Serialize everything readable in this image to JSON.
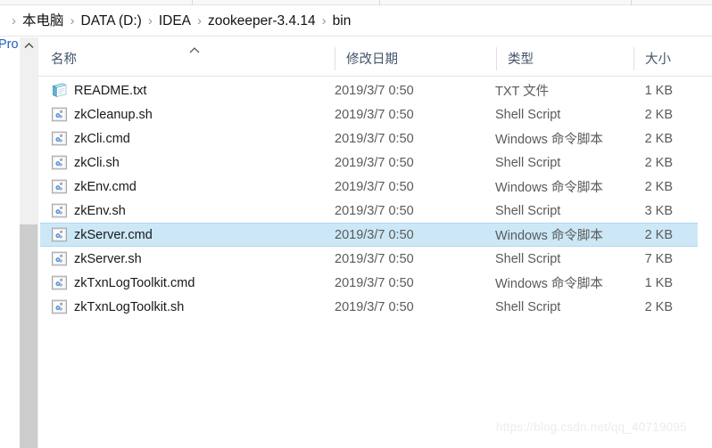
{
  "window": {
    "app": "file-explorer"
  },
  "breadcrumb": {
    "separator": "›",
    "items": [
      {
        "label": "本电脑"
      },
      {
        "label": "DATA (D:)"
      },
      {
        "label": "IDEA"
      },
      {
        "label": "zookeeper-3.4.14"
      },
      {
        "label": "bin"
      }
    ]
  },
  "navigation_pane": {
    "clipped_item_label": "Pro",
    "scrollbar": {
      "up_arrow_icon": "chevron-up-icon"
    }
  },
  "columns": {
    "name": "名称",
    "date_modified": "修改日期",
    "type": "类型",
    "size": "大小",
    "sort_column": "名称",
    "sort_direction_icon": "sort-ascending-icon"
  },
  "files": [
    {
      "name": "README.txt",
      "date": "2019/3/7 0:50",
      "type": "TXT 文件",
      "size": "1 KB",
      "icon": "text-document-icon",
      "selected": false
    },
    {
      "name": "zkCleanup.sh",
      "date": "2019/3/7 0:50",
      "type": "Shell Script",
      "size": "2 KB",
      "icon": "script-file-icon",
      "selected": false
    },
    {
      "name": "zkCli.cmd",
      "date": "2019/3/7 0:50",
      "type": "Windows 命令脚本",
      "size": "2 KB",
      "icon": "script-file-icon",
      "selected": false
    },
    {
      "name": "zkCli.sh",
      "date": "2019/3/7 0:50",
      "type": "Shell Script",
      "size": "2 KB",
      "icon": "script-file-icon",
      "selected": false
    },
    {
      "name": "zkEnv.cmd",
      "date": "2019/3/7 0:50",
      "type": "Windows 命令脚本",
      "size": "2 KB",
      "icon": "script-file-icon",
      "selected": false
    },
    {
      "name": "zkEnv.sh",
      "date": "2019/3/7 0:50",
      "type": "Shell Script",
      "size": "3 KB",
      "icon": "script-file-icon",
      "selected": false
    },
    {
      "name": "zkServer.cmd",
      "date": "2019/3/7 0:50",
      "type": "Windows 命令脚本",
      "size": "2 KB",
      "icon": "script-file-icon",
      "selected": true
    },
    {
      "name": "zkServer.sh",
      "date": "2019/3/7 0:50",
      "type": "Shell Script",
      "size": "7 KB",
      "icon": "script-file-icon",
      "selected": false
    },
    {
      "name": "zkTxnLogToolkit.cmd",
      "date": "2019/3/7 0:50",
      "type": "Windows 命令脚本",
      "size": "1 KB",
      "icon": "script-file-icon",
      "selected": false
    },
    {
      "name": "zkTxnLogToolkit.sh",
      "date": "2019/3/7 0:50",
      "type": "Shell Script",
      "size": "2 KB",
      "icon": "script-file-icon",
      "selected": false
    }
  ],
  "watermark": {
    "text": "https://blog.csdn.net/qq_40719095"
  },
  "colors": {
    "selection_fill": "#cce8f7",
    "selection_border": "#afd9ef",
    "header_text": "#44546a",
    "row_text": "#191919",
    "secondary_text": "#5a5a5a",
    "scrollbar_track": "#f0f0f0",
    "scrollbar_thumb": "#cdcdcd",
    "nav_link": "#1f5fbf"
  }
}
